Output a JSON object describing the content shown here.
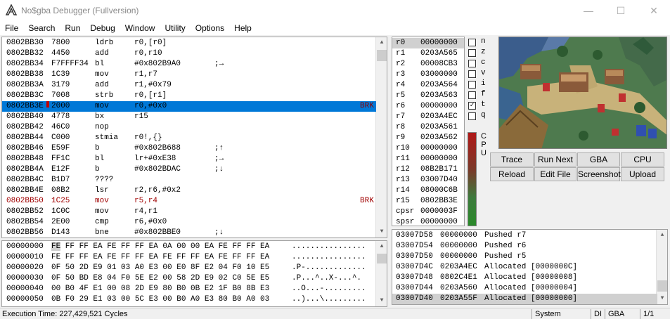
{
  "window": {
    "title": "No$gba Debugger (Fullversion)",
    "minimize_glyph": "—",
    "maximize_glyph": "☐",
    "close_glyph": "✕"
  },
  "menu": [
    "File",
    "Search",
    "Run",
    "Debug",
    "Window",
    "Utility",
    "Options",
    "Help"
  ],
  "disassembly": [
    {
      "addr": "0802BB30",
      "hex": "7800",
      "op": "ldrb",
      "args": "r0,[r0]",
      "comment": "",
      "brk": ""
    },
    {
      "addr": "0802BB32",
      "hex": "4450",
      "op": "add",
      "args": "r0,r10",
      "comment": "",
      "brk": ""
    },
    {
      "addr": "0802BB34",
      "hex": "F7FFFF34",
      "op": "bl",
      "args": "#0x802B9A0",
      "comment": ";→",
      "brk": ""
    },
    {
      "addr": "0802BB38",
      "hex": "1C39",
      "op": "mov",
      "args": "r1,r7",
      "comment": "",
      "brk": ""
    },
    {
      "addr": "0802BB3A",
      "hex": "3179",
      "op": "add",
      "args": "r1,#0x79",
      "comment": "",
      "brk": ""
    },
    {
      "addr": "0802BB3C",
      "hex": "7008",
      "op": "strb",
      "args": "r0,[r1]",
      "comment": "",
      "brk": ""
    },
    {
      "addr": "0802BB3E",
      "hex": "2000",
      "op": "mov",
      "args": "r0,#0x0",
      "comment": "",
      "brk": "BRK"
    },
    {
      "addr": "0802BB40",
      "hex": "4778",
      "op": "bx",
      "args": "r15",
      "comment": "",
      "brk": ""
    },
    {
      "addr": "0802BB42",
      "hex": "46C0",
      "op": "nop",
      "args": "",
      "comment": "",
      "brk": ""
    },
    {
      "addr": "0802BB44",
      "hex": "C000",
      "op": "stmia",
      "args": "r0!,{}",
      "comment": "",
      "brk": ""
    },
    {
      "addr": "0802BB46",
      "hex": "E59F",
      "op": "b",
      "args": "#0x802B688",
      "comment": ";↑",
      "brk": ""
    },
    {
      "addr": "0802BB48",
      "hex": "FF1C",
      "op": "bl",
      "args": "lr+#0xE38",
      "comment": ";→",
      "brk": ""
    },
    {
      "addr": "0802BB4A",
      "hex": "E12F",
      "op": "b",
      "args": "#0x802BDAC",
      "comment": ";↓",
      "brk": ""
    },
    {
      "addr": "0802BB4C",
      "hex": "B1D7",
      "op": "????",
      "args": "",
      "comment": "",
      "brk": ""
    },
    {
      "addr": "0802BB4E",
      "hex": "08B2",
      "op": "lsr",
      "args": "r2,r6,#0x2",
      "comment": "",
      "brk": ""
    },
    {
      "addr": "0802BB50",
      "hex": "1C25",
      "op": "mov",
      "args": "r5,r4",
      "comment": "",
      "brk": "BRK"
    },
    {
      "addr": "0802BB52",
      "hex": "1C0C",
      "op": "mov",
      "args": "r4,r1",
      "comment": "",
      "brk": ""
    },
    {
      "addr": "0802BB54",
      "hex": "2E00",
      "op": "cmp",
      "args": "r6,#0x0",
      "comment": "",
      "brk": ""
    },
    {
      "addr": "0802BB56",
      "hex": "D143",
      "op": "bne",
      "args": "#0x802BBE0",
      "comment": ";↓",
      "brk": ""
    }
  ],
  "hexdump": [
    {
      "addr": "00000000",
      "first": "FE",
      "bytes": " FF FF EA FE FF FF EA 0A 00 00 EA FE FF FF EA",
      "ascii": "................"
    },
    {
      "addr": "00000010",
      "first": "FE",
      "bytes": " FF FF EA FE FF FF EA FE FF FF EA FE FF FF EA",
      "ascii": "................"
    },
    {
      "addr": "00000020",
      "first": "0F",
      "bytes": " 50 2D E9 01 03 A0 E3 00 E0 8F E2 04 F0 10 E5",
      "ascii": ".P-............."
    },
    {
      "addr": "00000030",
      "first": "0F",
      "bytes": " 50 BD E8 04 F0 5E E2 00 58 2D E9 02 C0 5E E5",
      "ascii": ".P...^..X-...^."
    },
    {
      "addr": "00000040",
      "first": "00",
      "bytes": " B0 4F E1 00 08 2D E9 80 B0 0B E2 1F B0 8B E3",
      "ascii": "..O...-........."
    },
    {
      "addr": "00000050",
      "first": "0B",
      "bytes": " F0 29 E1 03 00 5C E3 00 B0 A0 E3 80 B0 A0 03",
      "ascii": "..)...\\........."
    }
  ],
  "registers": [
    {
      "name": "r0",
      "val": "00000000"
    },
    {
      "name": "r1",
      "val": "0203A565"
    },
    {
      "name": "r2",
      "val": "00008CB3"
    },
    {
      "name": "r3",
      "val": "03000000"
    },
    {
      "name": "r4",
      "val": "0203A564"
    },
    {
      "name": "r5",
      "val": "0203A563"
    },
    {
      "name": "r6",
      "val": "00000000"
    },
    {
      "name": "r7",
      "val": "0203A4EC"
    },
    {
      "name": "r8",
      "val": "0203A561"
    },
    {
      "name": "r9",
      "val": "0203A562"
    },
    {
      "name": "r10",
      "val": "00000000"
    },
    {
      "name": "r11",
      "val": "00000000"
    },
    {
      "name": "r12",
      "val": "08B2B171"
    },
    {
      "name": "r13",
      "val": "03007D40"
    },
    {
      "name": "r14",
      "val": "08000C6B"
    },
    {
      "name": "r15",
      "val": "0802BB3E"
    },
    {
      "name": "cpsr",
      "val": "0000003F"
    },
    {
      "name": "spsr",
      "val": "00000000"
    }
  ],
  "flags": [
    {
      "name": "n",
      "checked": false
    },
    {
      "name": "z",
      "checked": false
    },
    {
      "name": "c",
      "checked": false
    },
    {
      "name": "v",
      "checked": false
    },
    {
      "name": "i",
      "checked": false
    },
    {
      "name": "f",
      "checked": false
    },
    {
      "name": "t",
      "checked": true
    },
    {
      "name": "q",
      "checked": false
    }
  ],
  "cpu_label": [
    "C",
    "P",
    "U"
  ],
  "buttons": {
    "trace": "Trace",
    "run_next": "Run Next",
    "gba_specs": "GBA Specs",
    "cpu_specs": "CPU Specs",
    "reload": "Reload",
    "edit_file": "Edit File",
    "screenshot": "Screenshot",
    "upload": "Upload"
  },
  "log": [
    {
      "a": "03007D58",
      "b": "00000000",
      "c": "Pushed r7"
    },
    {
      "a": "03007D54",
      "b": "00000000",
      "c": "Pushed r6"
    },
    {
      "a": "03007D50",
      "b": "00000000",
      "c": "Pushed r5"
    },
    {
      "a": "03007D4C",
      "b": "0203A4EC",
      "c": "Allocated [0000000C]"
    },
    {
      "a": "03007D48",
      "b": "0802C4E1",
      "c": "Allocated [00000008]"
    },
    {
      "a": "03007D44",
      "b": "0203A560",
      "c": "Allocated [00000004]"
    },
    {
      "a": "03007D40",
      "b": "0203A55F",
      "c": "Allocated [00000000]"
    }
  ],
  "status": {
    "exec_time": "Execution Time: 227,429,521 Cycles",
    "mode": "System",
    "di": "DI",
    "system": "GBA",
    "page": "1/1"
  },
  "colors": {
    "selection": "#0078d7",
    "breakpoint_text": "#a00000"
  }
}
